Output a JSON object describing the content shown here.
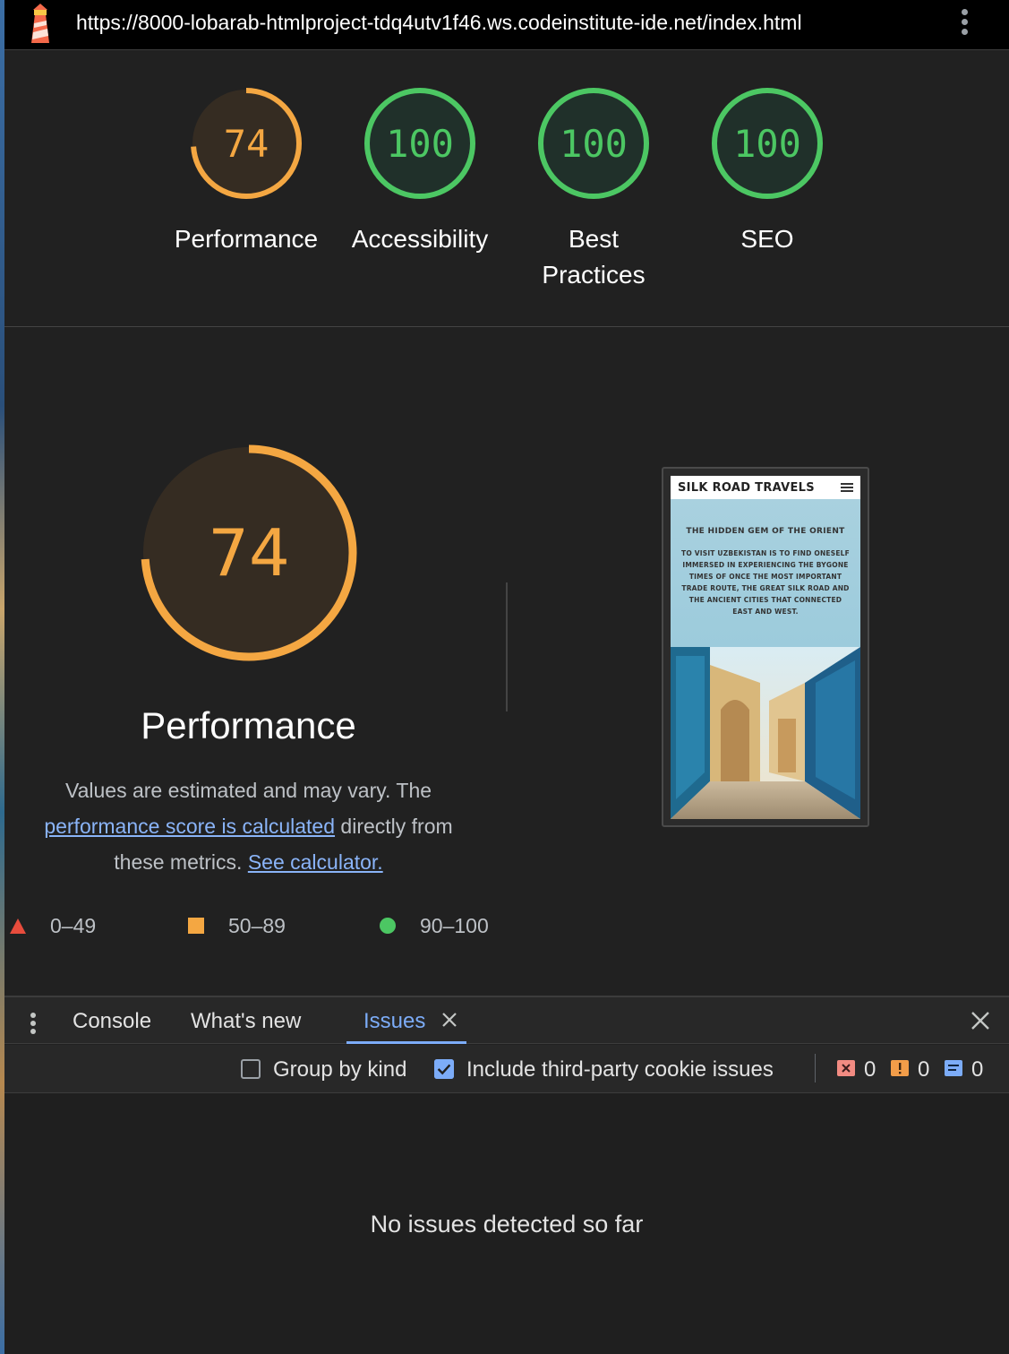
{
  "browser": {
    "url": "https://8000-lobarab-htmlproject-tdq4utv1f46.ws.codeinstitute-ide.net/index.html",
    "icons": {
      "app": "lighthouse-icon",
      "menu": "more-vert-icon"
    }
  },
  "scores": [
    {
      "label": "Performance",
      "value": "74",
      "fraction": 0.74,
      "color": "#f4a742"
    },
    {
      "label": "Accessibility",
      "value": "100",
      "fraction": 1.0,
      "color": "#4cc763"
    },
    {
      "label": "Best Practices",
      "value": "100",
      "fraction": 1.0,
      "color": "#4cc763"
    },
    {
      "label": "SEO",
      "value": "100",
      "fraction": 1.0,
      "color": "#4cc763"
    }
  ],
  "performance": {
    "score": "74",
    "fraction": 0.74,
    "title": "Performance",
    "desc_prefix": "Values are estimated and may vary. The ",
    "desc_link": "performance score is calculated",
    "desc_middle": " directly from these metrics. ",
    "calc_link": "See calculator.",
    "legend": [
      {
        "range": "0–49",
        "shape": "triangle",
        "color": "#e74c3c"
      },
      {
        "range": "50–89",
        "shape": "square",
        "color": "#f4a742"
      },
      {
        "range": "90–100",
        "shape": "circle",
        "color": "#4cc763"
      }
    ]
  },
  "screenshot": {
    "site_title": "SILK ROAD TRAVELS",
    "hero_heading": "THE HIDDEN GEM OF THE ORIENT",
    "hero_text": "TO VISIT UZBEKISTAN IS TO FIND ONESELF IMMERSED IN EXPERIENCING THE BYGONE TIMES OF ONCE THE MOST IMPORTANT TRADE ROUTE, THE GREAT SILK ROAD AND THE ANCIENT CITIES THAT CONNECTED EAST AND WEST."
  },
  "drawer": {
    "tabs": [
      "Console",
      "What's new",
      "Issues"
    ],
    "active_tab": "Issues"
  },
  "toolbar": {
    "group_by_kind": "Group by kind",
    "include_third_party": "Include third-party cookie issues",
    "error_count": "0",
    "warning_count": "0",
    "info_count": "0",
    "colors": {
      "error": "#f28b82",
      "warning": "#f29d49",
      "info": "#7cacf8"
    }
  },
  "issues": {
    "empty_message": "No issues detected so far"
  }
}
